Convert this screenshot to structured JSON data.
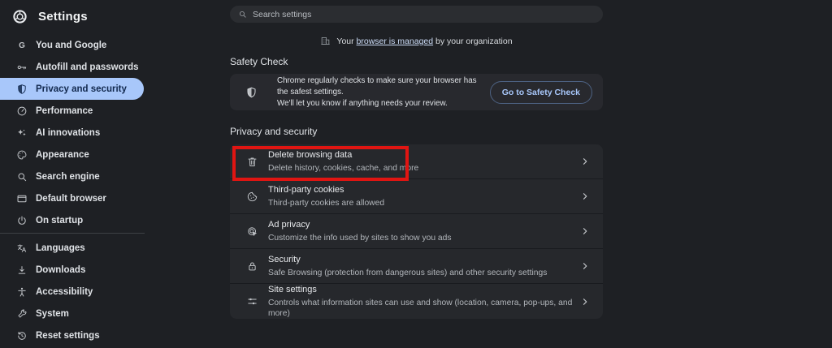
{
  "window": {
    "title": "Settings"
  },
  "colors": {
    "accent_blue": "#a8c7fa",
    "selected_item_bg": "#a8c7fa",
    "selected_item_text": "#12294e",
    "annotation_red": "#e01512",
    "page_bg": "#1e2024",
    "card_bg": "#28292e"
  },
  "header": {
    "title": "Settings",
    "logo_icon": "chrome-logo"
  },
  "sidebar": {
    "items_primary": [
      {
        "label": "You and Google",
        "icon": "google-g",
        "selected": false
      },
      {
        "label": "Autofill and passwords",
        "icon": "key",
        "selected": false
      },
      {
        "label": "Privacy and security",
        "icon": "shield",
        "selected": true
      },
      {
        "label": "Performance",
        "icon": "speedometer",
        "selected": false
      },
      {
        "label": "AI innovations",
        "icon": "sparkle",
        "selected": false
      },
      {
        "label": "Appearance",
        "icon": "palette",
        "selected": false
      },
      {
        "label": "Search engine",
        "icon": "magnifier",
        "selected": false
      },
      {
        "label": "Default browser",
        "icon": "browser-window",
        "selected": false
      },
      {
        "label": "On startup",
        "icon": "power",
        "selected": false
      }
    ],
    "items_secondary": [
      {
        "label": "Languages",
        "icon": "translate",
        "selected": false
      },
      {
        "label": "Downloads",
        "icon": "download",
        "selected": false
      },
      {
        "label": "Accessibility",
        "icon": "accessibility-person",
        "selected": false
      },
      {
        "label": "System",
        "icon": "wrench",
        "selected": false
      },
      {
        "label": "Reset settings",
        "icon": "reset",
        "selected": false
      }
    ]
  },
  "search": {
    "placeholder": "Search settings",
    "icon": "magnifier"
  },
  "managed_notice": {
    "icon": "building",
    "prefix": "Your ",
    "link": "browser is managed",
    "suffix": " by your organization"
  },
  "safety_check": {
    "heading": "Safety Check",
    "icon": "shield",
    "description_line1": "Chrome regularly checks to make sure your browser has the safest settings.",
    "description_line2": "We'll let you know if anything needs your review.",
    "button": "Go to Safety Check"
  },
  "privacy_section": {
    "heading": "Privacy and security",
    "rows": [
      {
        "title": "Delete browsing data",
        "subtitle": "Delete history, cookies, cache, and more",
        "icon": "trash",
        "highlighted": true
      },
      {
        "title": "Third-party cookies",
        "subtitle": "Third-party cookies are allowed",
        "icon": "cookie",
        "highlighted": false
      },
      {
        "title": "Ad privacy",
        "subtitle": "Customize the info used by sites to show you ads",
        "icon": "ads-click",
        "highlighted": false
      },
      {
        "title": "Security",
        "subtitle": "Safe Browsing (protection from dangerous sites) and other security settings",
        "icon": "lock",
        "highlighted": false
      },
      {
        "title": "Site settings",
        "subtitle": "Controls what information sites can use and show (location, camera, pop-ups, and more)",
        "icon": "tune",
        "highlighted": false
      }
    ]
  }
}
